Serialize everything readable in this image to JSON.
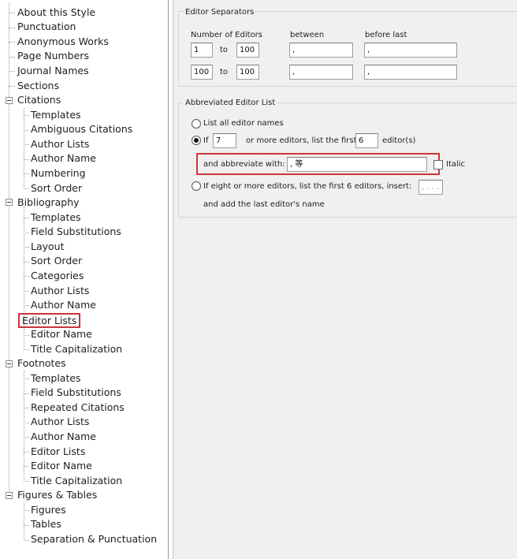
{
  "tree": {
    "about": "About this Style",
    "punctuation": "Punctuation",
    "anonymous_works": "Anonymous Works",
    "page_numbers": "Page Numbers",
    "journal_names": "Journal Names",
    "sections": "Sections",
    "citations": {
      "label": "Citations",
      "items": [
        "Templates",
        "Ambiguous Citations",
        "Author Lists",
        "Author Name",
        "Numbering",
        "Sort Order"
      ]
    },
    "bibliography": {
      "label": "Bibliography",
      "items": [
        "Templates",
        "Field Substitutions",
        "Layout",
        "Sort Order",
        "Categories",
        "Author Lists",
        "Author Name",
        "Editor Lists",
        "Editor Name",
        "Title Capitalization"
      ],
      "selected_index": 7
    },
    "footnotes": {
      "label": "Footnotes",
      "items": [
        "Templates",
        "Field Substitutions",
        "Repeated Citations",
        "Author Lists",
        "Author Name",
        "Editor Lists",
        "Editor Name",
        "Title Capitalization"
      ]
    },
    "figures_tables": {
      "label": "Figures & Tables",
      "items": [
        "Figures",
        "Tables",
        "Separation & Punctuation"
      ]
    }
  },
  "editor_separators": {
    "title": "Editor Separators",
    "col_number": "Number of Editors",
    "col_between": "between",
    "col_before_last": "before last",
    "to_label": "to",
    "rows": [
      {
        "from": "1",
        "to": "100",
        "between": ",",
        "before_last": ","
      },
      {
        "from": "100",
        "to": "100",
        "between": ",",
        "before_last": ","
      }
    ]
  },
  "abbreviated_list": {
    "title": "Abbreviated Editor List",
    "opt_list_all": "List all editor names",
    "opt_if": "If",
    "if_count": "7",
    "more_editors_text": "or more editors, list the first",
    "first_count": "6",
    "editors_suffix": "editor(s)",
    "abbreviate_label": "and abbreviate with:",
    "abbreviate_value": ", 等",
    "italic_label": "Italic",
    "opt_eight_more": "If eight or more editors, list the first 6 editors, insert:",
    "insert_value": ", . . .",
    "add_last_text": "and add the last editor's name",
    "selected_option": "if"
  }
}
